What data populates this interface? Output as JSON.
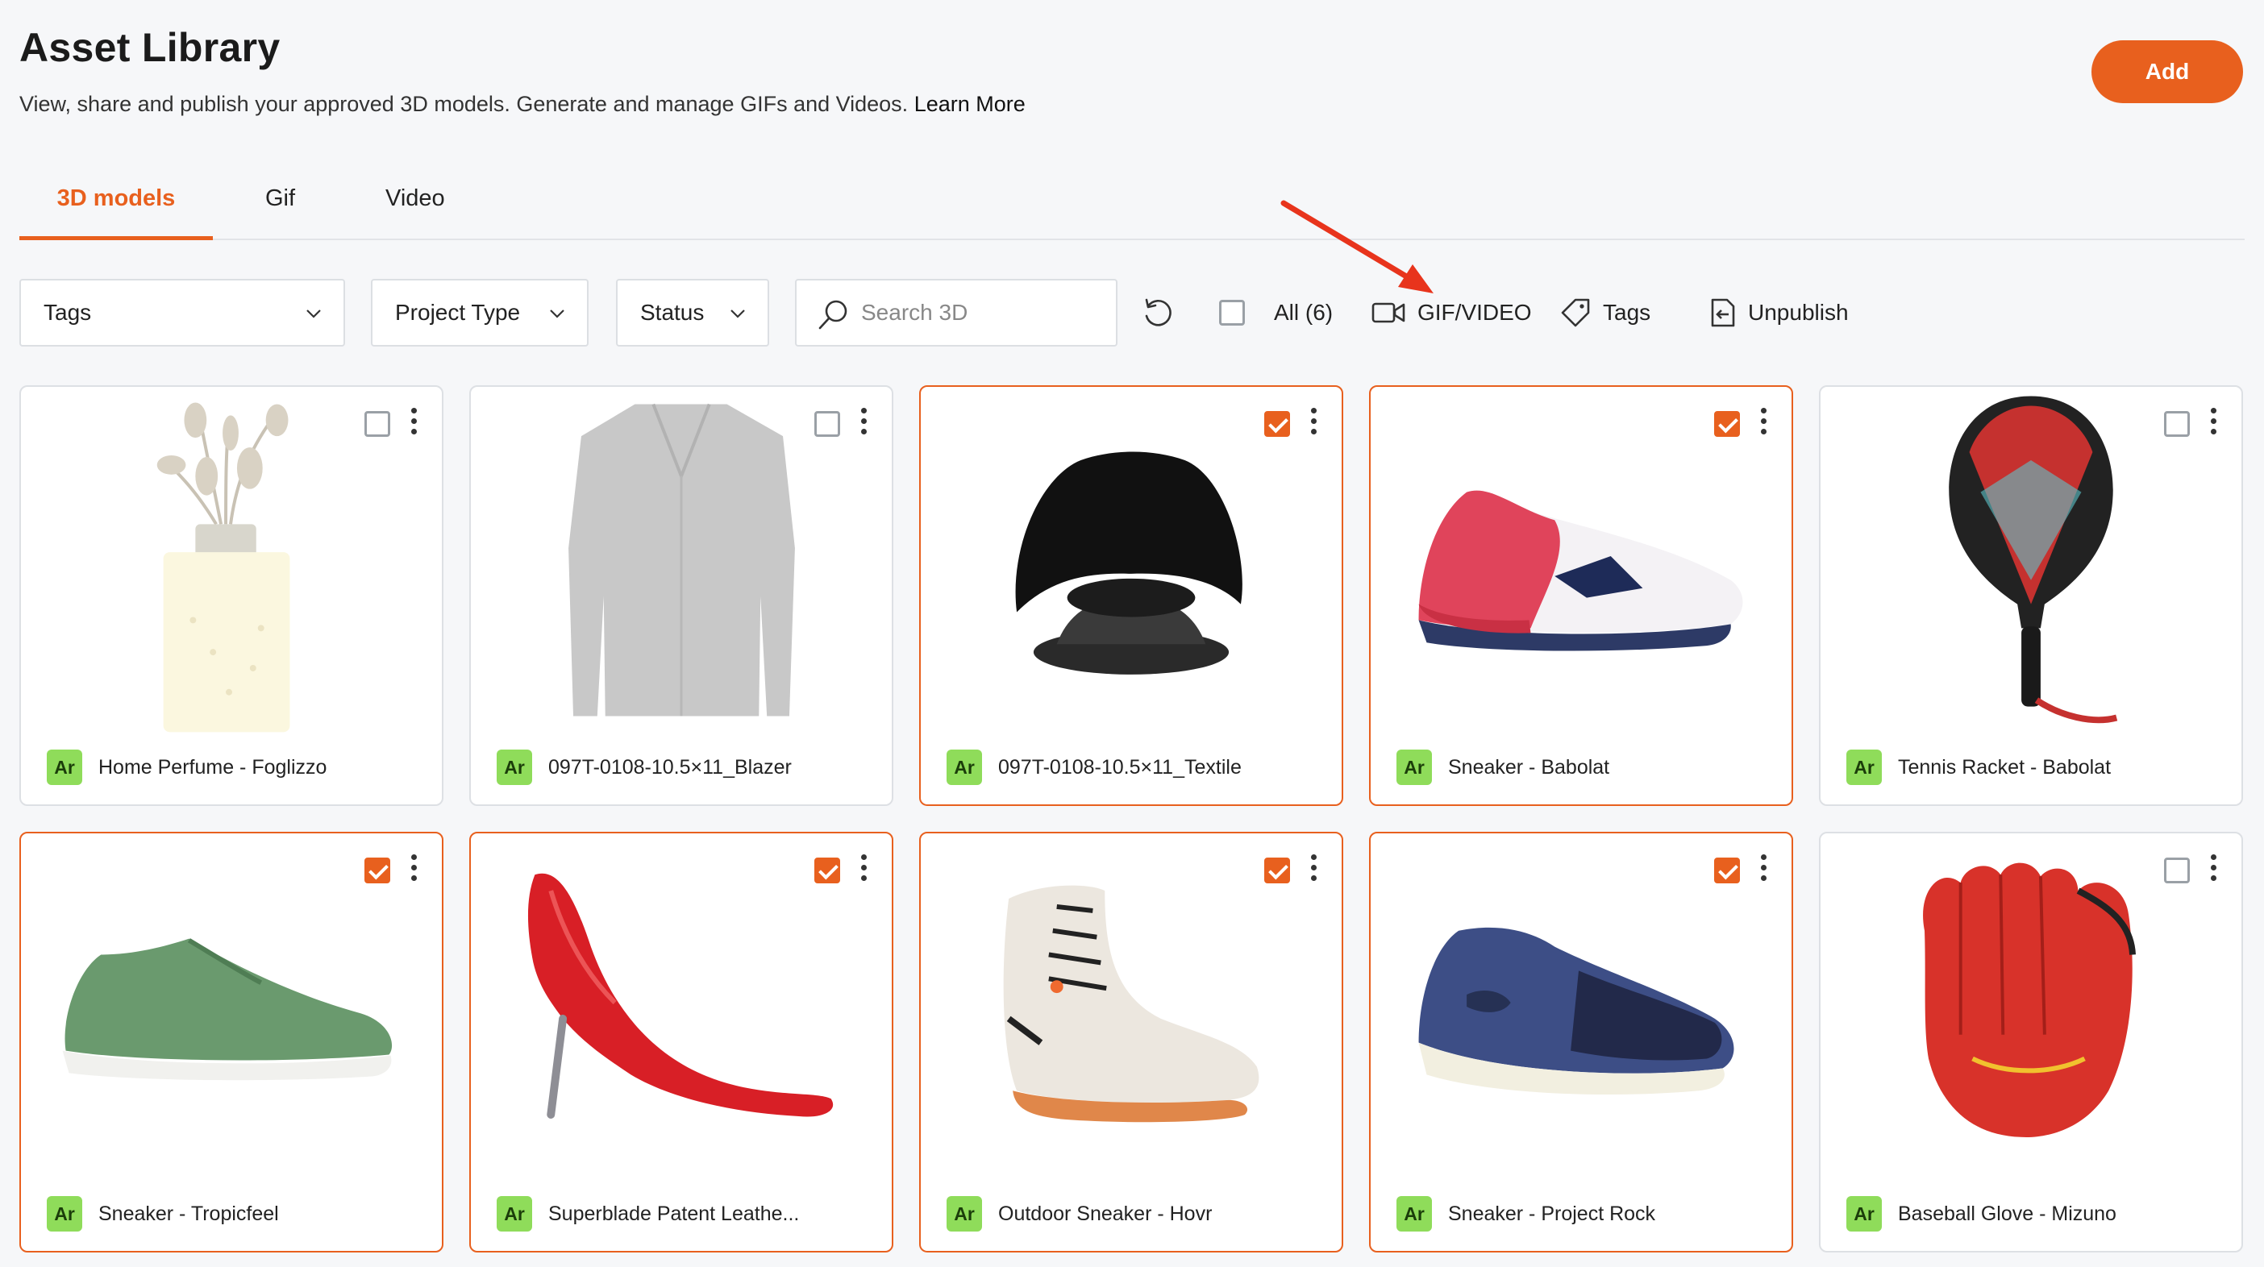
{
  "header": {
    "title": "Asset Library",
    "subtitle": "View, share and publish your approved 3D models. Generate and manage GIFs and Videos.",
    "learn_more": "Learn More",
    "add_label": "Add"
  },
  "tabs": [
    {
      "label": "3D models",
      "active": true
    },
    {
      "label": "Gif",
      "active": false
    },
    {
      "label": "Video",
      "active": false
    }
  ],
  "filters": {
    "tags": "Tags",
    "project_type": "Project Type",
    "status": "Status",
    "search_placeholder": "Search 3D"
  },
  "actions": {
    "all_label": "All (6)",
    "gif_video": "GIF/VIDEO",
    "tags": "Tags",
    "unpublish": "Unpublish"
  },
  "colors": {
    "accent": "#e8601e",
    "badge": "#8fdc5a"
  },
  "assets": [
    {
      "badge": "Ar",
      "name": "Home Perfume - Foglizzo",
      "checked": false,
      "icon": "vase-icon"
    },
    {
      "badge": "Ar",
      "name": "097T-0108-10.5×11_Blazer",
      "checked": false,
      "icon": "blazer-icon"
    },
    {
      "badge": "Ar",
      "name": "097T-0108-10.5×11_Textile",
      "checked": true,
      "icon": "textile-stand-icon"
    },
    {
      "badge": "Ar",
      "name": "Sneaker - Babolat",
      "checked": true,
      "icon": "sneaker-icon"
    },
    {
      "badge": "Ar",
      "name": "Tennis Racket - Babolat",
      "checked": false,
      "icon": "padel-racket-icon"
    },
    {
      "badge": "Ar",
      "name": "Sneaker - Tropicfeel",
      "checked": true,
      "icon": "sneaker-icon"
    },
    {
      "badge": "Ar",
      "name": "Superblade Patent Leathe...",
      "checked": true,
      "icon": "high-heel-icon"
    },
    {
      "badge": "Ar",
      "name": "Outdoor Sneaker - Hovr",
      "checked": true,
      "icon": "boot-icon"
    },
    {
      "badge": "Ar",
      "name": "Sneaker - Project Rock",
      "checked": true,
      "icon": "sneaker-icon"
    },
    {
      "badge": "Ar",
      "name": "Baseball Glove - Mizuno",
      "checked": false,
      "icon": "glove-icon"
    }
  ]
}
